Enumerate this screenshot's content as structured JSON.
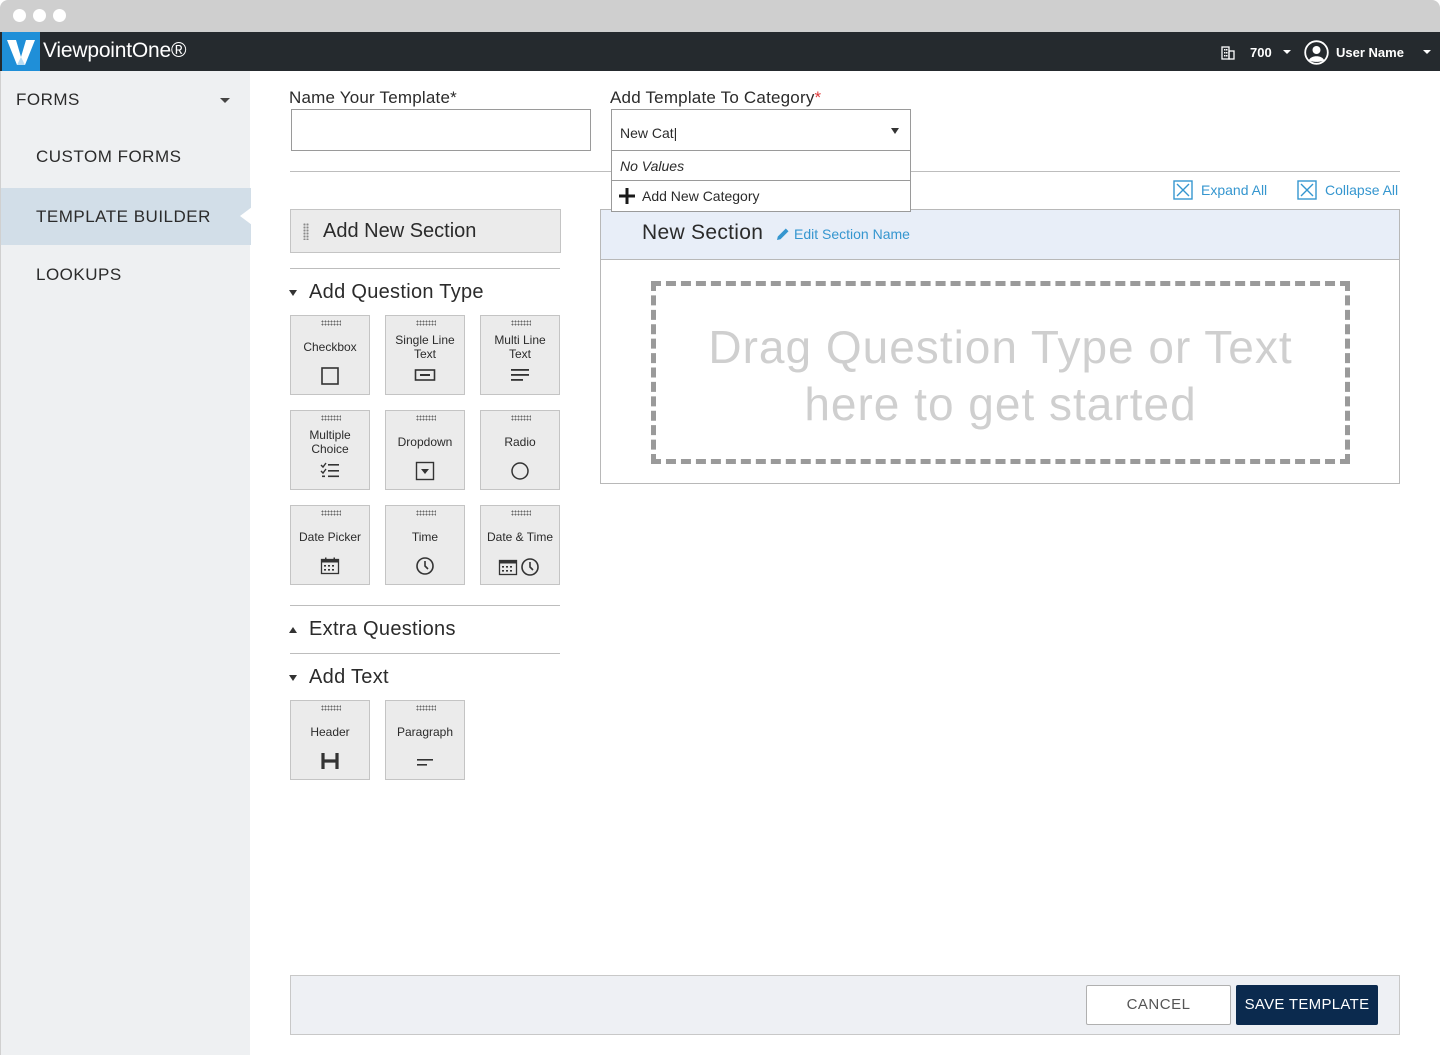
{
  "topbar": {
    "app_title": "ViewpointOne®",
    "company_number": "700",
    "user_name": "User Name"
  },
  "sidebar": {
    "section_label": "FORMS",
    "items": [
      {
        "label": "CUSTOM FORMS",
        "active": false
      },
      {
        "label": "TEMPLATE BUILDER",
        "active": true
      },
      {
        "label": "LOOKUPS",
        "active": false
      }
    ]
  },
  "form": {
    "name_label": "Name Your Template*",
    "name_value": "",
    "category_label": "Add Template To Category",
    "category_required_mark": "*",
    "category_value": "New Cat|",
    "dropdown": {
      "no_values": "No Values",
      "add_new": "Add New Category"
    }
  },
  "toolbar": {
    "expand_all": "Expand All",
    "collapse_all": "Collapse All"
  },
  "palette": {
    "add_section": "Add New Section",
    "question_group_title": "Add Question Type",
    "question_types": [
      {
        "line1": "Checkbox",
        "line2": "",
        "icon": "checkbox-icon"
      },
      {
        "line1": "Single Line",
        "line2": "Text",
        "icon": "single-line-text-icon"
      },
      {
        "line1": "Multi Line",
        "line2": "Text",
        "icon": "multi-line-text-icon"
      },
      {
        "line1": "Multiple",
        "line2": "Choice",
        "icon": "multiple-choice-icon"
      },
      {
        "line1": "Dropdown",
        "line2": "",
        "icon": "dropdown-icon"
      },
      {
        "line1": "Radio",
        "line2": "",
        "icon": "radio-icon"
      },
      {
        "line1": "Date Picker",
        "line2": "",
        "icon": "calendar-icon"
      },
      {
        "line1": "Time",
        "line2": "",
        "icon": "clock-icon"
      },
      {
        "line1": "Date & Time",
        "line2": "",
        "icon": "calendar-clock-icon"
      }
    ],
    "extra_group_title": "Extra Questions",
    "text_group_title": "Add Text",
    "text_types": [
      {
        "line1": "Header",
        "icon": "header-icon"
      },
      {
        "line1": "Paragraph",
        "icon": "paragraph-icon"
      }
    ]
  },
  "section": {
    "name": "New Section",
    "edit_label": "Edit Section Name",
    "dropzone_line1": "Drag Question Type or Text",
    "dropzone_line2": "here to get started"
  },
  "footer": {
    "cancel_label": "CANCEL",
    "save_label": "SAVE TEMPLATE"
  },
  "colors": {
    "topbar_bg": "#252a2e",
    "logo_bg": "#1f8fd8",
    "accent_link": "#3596cf",
    "save_button_bg": "#0b2a4e",
    "sidebar_active_bg": "#d2dee8",
    "section_header_bg": "#e8eef8",
    "required": "#e03a3a"
  }
}
